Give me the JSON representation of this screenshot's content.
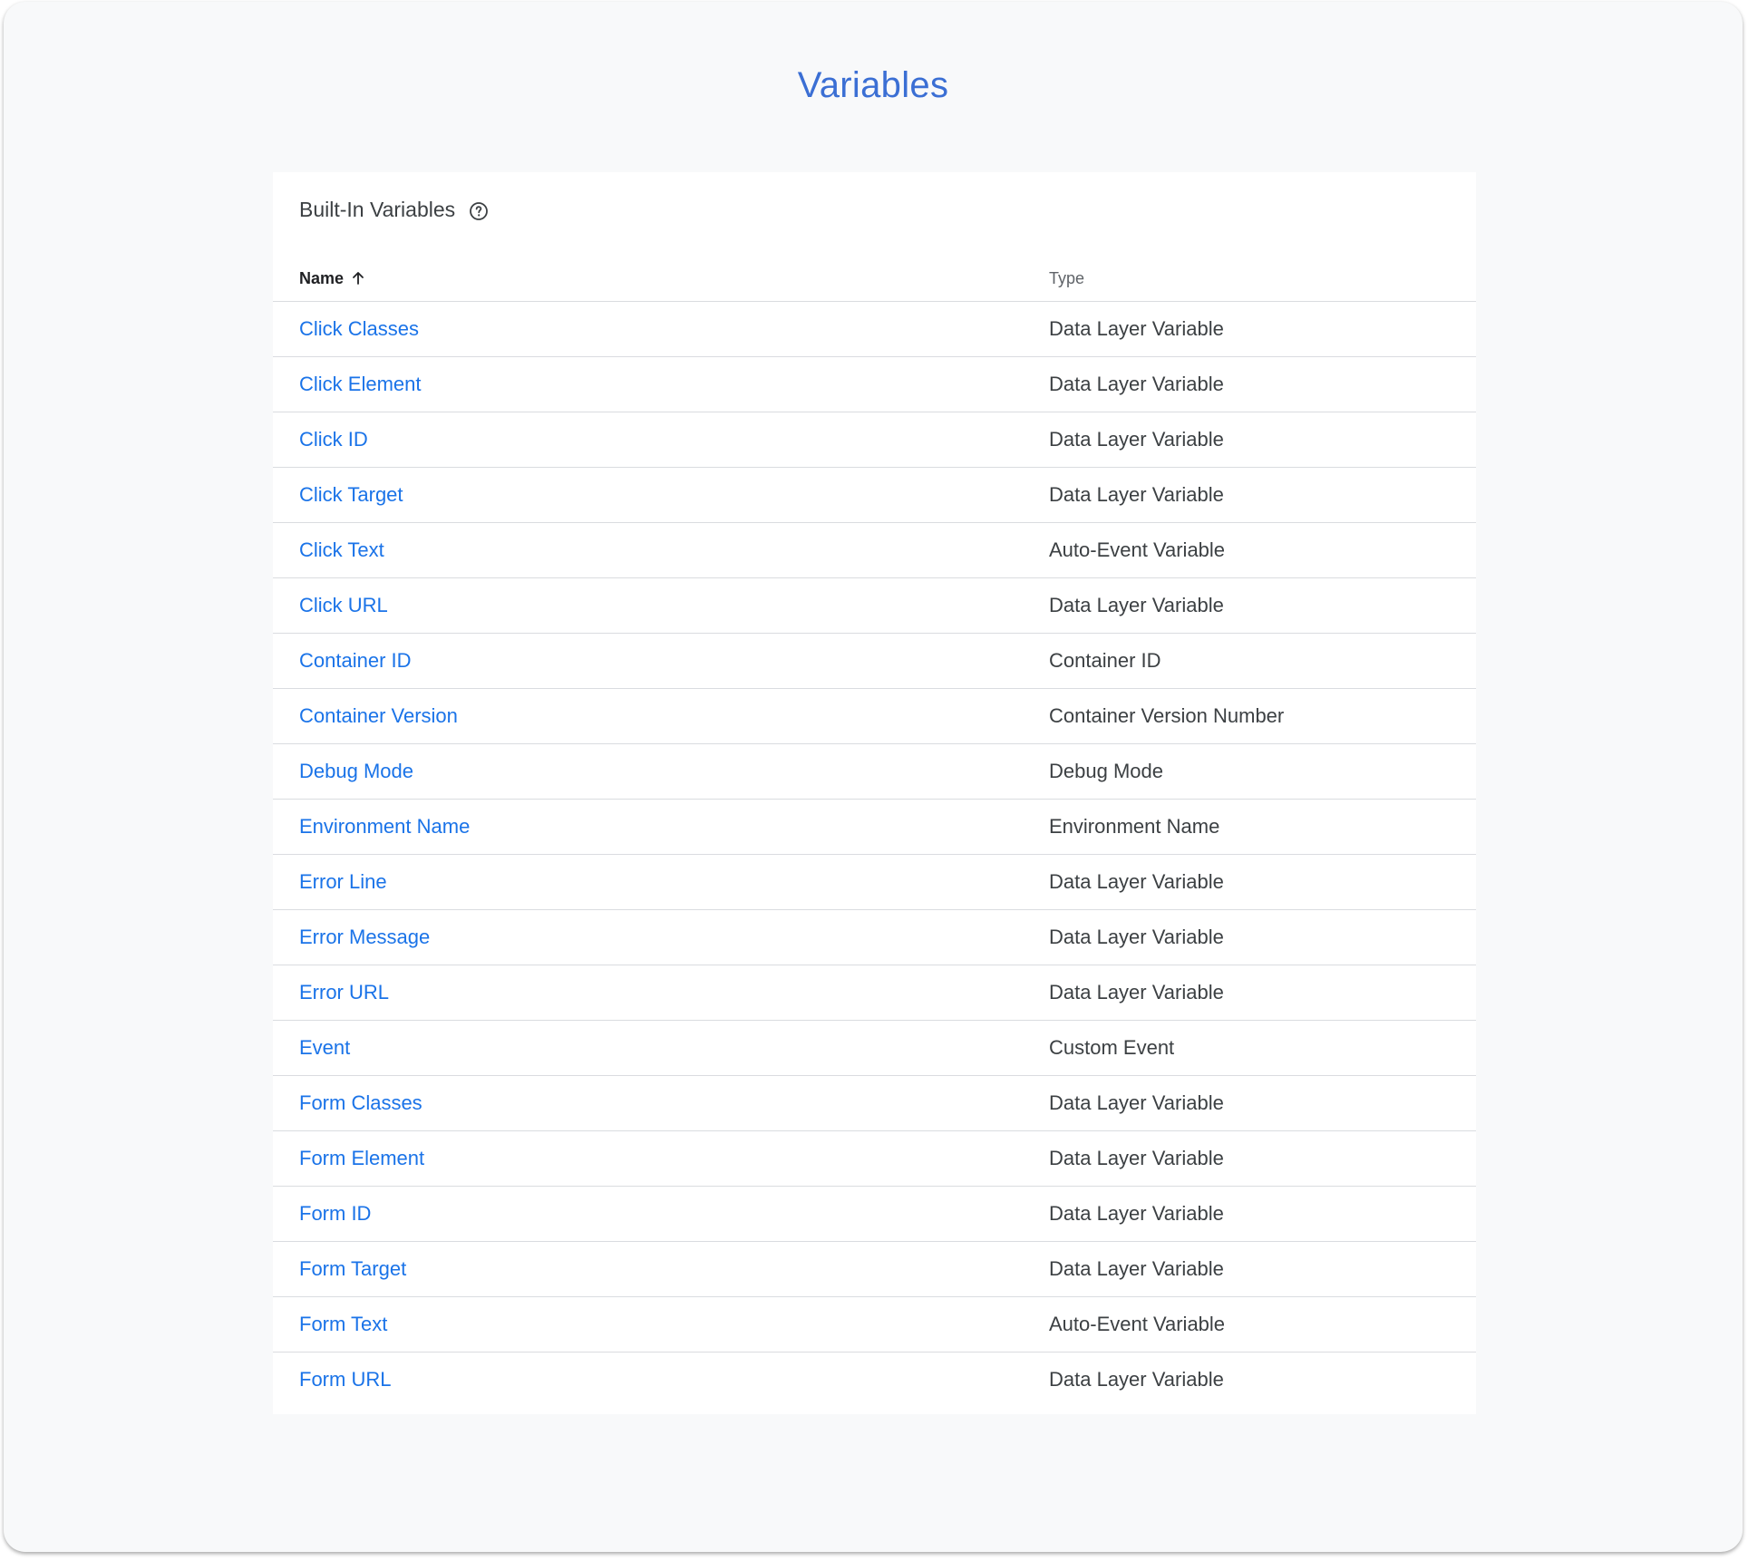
{
  "page": {
    "title": "Variables"
  },
  "card": {
    "title": "Built-In Variables",
    "help_icon": "help-circle-icon"
  },
  "table": {
    "columns": {
      "name": "Name",
      "type": "Type",
      "sort_icon": "arrow-up-icon"
    },
    "rows": [
      {
        "name": "Click Classes",
        "type": "Data Layer Variable"
      },
      {
        "name": "Click Element",
        "type": "Data Layer Variable"
      },
      {
        "name": "Click ID",
        "type": "Data Layer Variable"
      },
      {
        "name": "Click Target",
        "type": "Data Layer Variable"
      },
      {
        "name": "Click Text",
        "type": "Auto-Event Variable"
      },
      {
        "name": "Click URL",
        "type": "Data Layer Variable"
      },
      {
        "name": "Container ID",
        "type": "Container ID"
      },
      {
        "name": "Container Version",
        "type": "Container Version Number"
      },
      {
        "name": "Debug Mode",
        "type": "Debug Mode"
      },
      {
        "name": "Environment Name",
        "type": "Environment Name"
      },
      {
        "name": "Error Line",
        "type": "Data Layer Variable"
      },
      {
        "name": "Error Message",
        "type": "Data Layer Variable"
      },
      {
        "name": "Error URL",
        "type": "Data Layer Variable"
      },
      {
        "name": "Event",
        "type": "Custom Event"
      },
      {
        "name": "Form Classes",
        "type": "Data Layer Variable"
      },
      {
        "name": "Form Element",
        "type": "Data Layer Variable"
      },
      {
        "name": "Form ID",
        "type": "Data Layer Variable"
      },
      {
        "name": "Form Target",
        "type": "Data Layer Variable"
      },
      {
        "name": "Form Text",
        "type": "Auto-Event Variable"
      },
      {
        "name": "Form URL",
        "type": "Data Layer Variable"
      }
    ]
  },
  "colors": {
    "title": "#3b6fd4",
    "link": "#1a73e8",
    "background": "#f8f9fa",
    "card": "#ffffff",
    "divider": "#dadce0"
  }
}
